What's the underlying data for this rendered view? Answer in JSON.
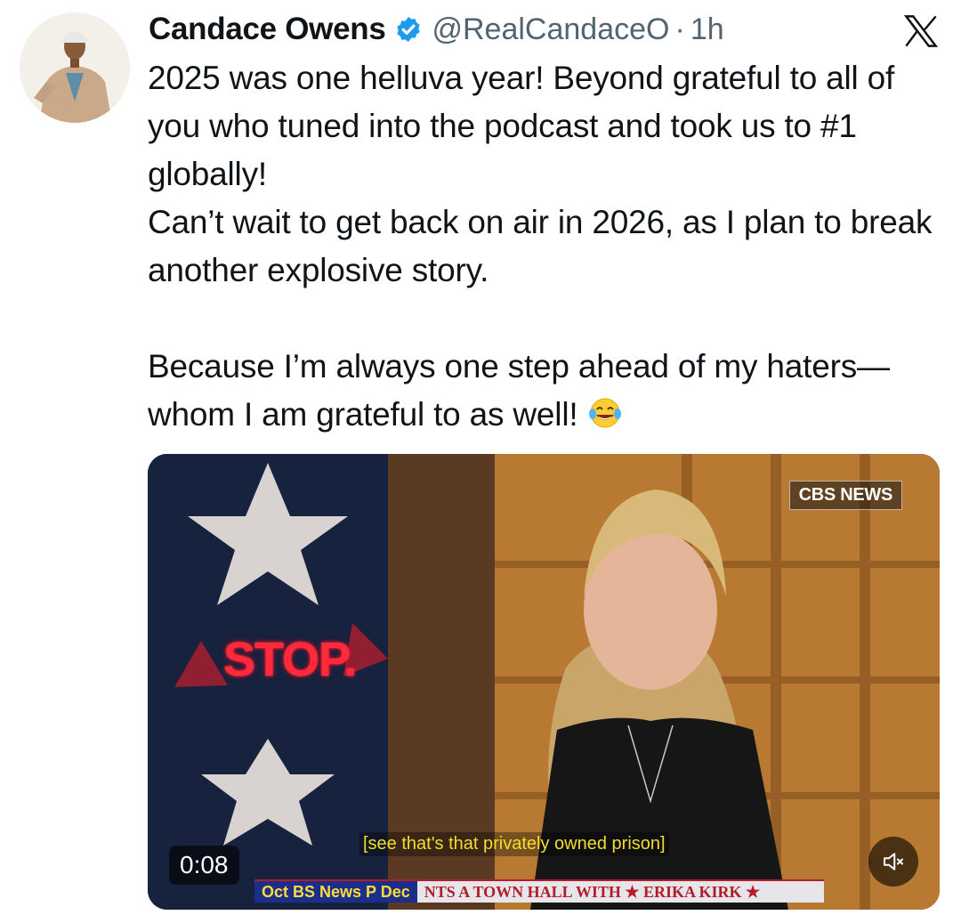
{
  "tweet": {
    "author_name": "Candace Owens",
    "handle": "@RealCandaceO",
    "separator": "·",
    "time": "1h",
    "paragraphs": [
      "2025 was one helluva year! Beyond grateful to all of you who tuned into the podcast and took us to #1 globally!",
      "Can’t wait to get back on air in 2026, as I plan to break another explosive story."
    ],
    "paragraph_3": "Because I’m always one step ahead of my haters—whom I am grateful to as well!",
    "emoji": "face-with-tears-of-joy"
  },
  "video": {
    "network_bug": "CBS NEWS",
    "stop_sign_text": "STOP.",
    "subtitle": "[see that's that privately owned prison]",
    "duration": "0:08",
    "ticker_left": "Oct BS News P Dec",
    "ticker_text": "NTS  A TOWN HALL WITH ★ ERIKA KIRK ★"
  },
  "icons": {
    "verified": "verified-badge-icon",
    "x_logo": "x-logo-icon",
    "mute": "speaker-muted-icon"
  },
  "colors": {
    "verified_blue": "#1d9bf0",
    "handle_gray": "#536471",
    "text": "#0f1419",
    "subtitle_yellow": "#f2de2c",
    "stop_red": "#ff2a3c"
  }
}
